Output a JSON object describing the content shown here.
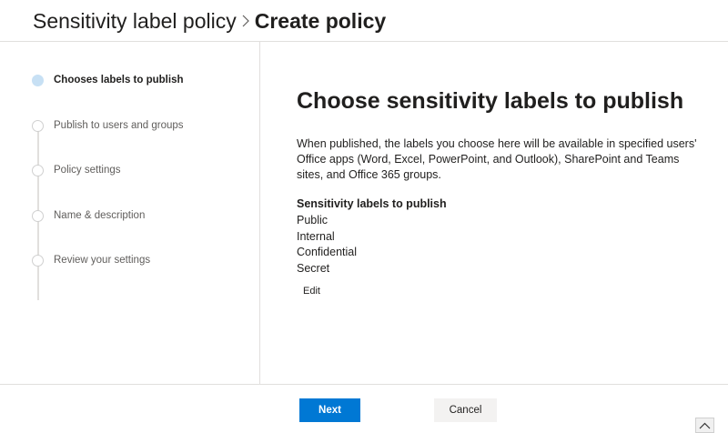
{
  "header": {
    "parent": "Sensitivity label policy",
    "current": "Create policy"
  },
  "steps": [
    {
      "label": "Chooses labels to publish",
      "state": "active"
    },
    {
      "label": "Publish to users and groups",
      "state": "pending"
    },
    {
      "label": "Policy settings",
      "state": "pending"
    },
    {
      "label": "Name & description",
      "state": "pending"
    },
    {
      "label": "Review your settings",
      "state": "pending"
    }
  ],
  "main": {
    "title": "Choose sensitivity labels to publish",
    "description": "When published, the labels you choose here will be available in specified users' Office apps (Word, Excel, PowerPoint, and Outlook), SharePoint and Teams sites, and Office 365 groups.",
    "labels_heading": "Sensitivity labels to publish",
    "labels": [
      "Public",
      "Internal",
      "Confidential",
      "Secret"
    ],
    "edit_label": "Edit"
  },
  "footer": {
    "next_label": "Next",
    "cancel_label": "Cancel"
  },
  "colors": {
    "accent": "#0078d4",
    "active_step": "#c7e0f4"
  }
}
